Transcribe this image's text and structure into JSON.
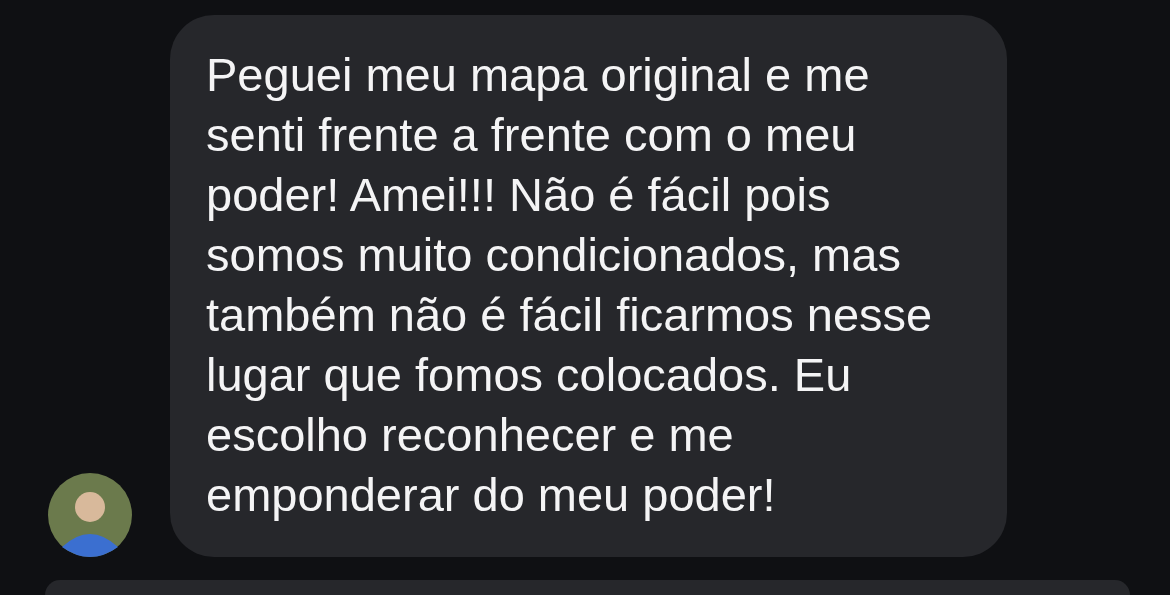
{
  "messages": [
    {
      "kind": "received",
      "text": "Peguei meu mapa original e me senti frente a frente com o meu poder! Amei!!! Não é fácil pois somos muito condicionados, mas também não é fácil ficarmos nesse lugar que fomos colocados. Eu escolho reconhecer e me emponderar do meu poder!"
    },
    {
      "kind": "partial"
    }
  ]
}
